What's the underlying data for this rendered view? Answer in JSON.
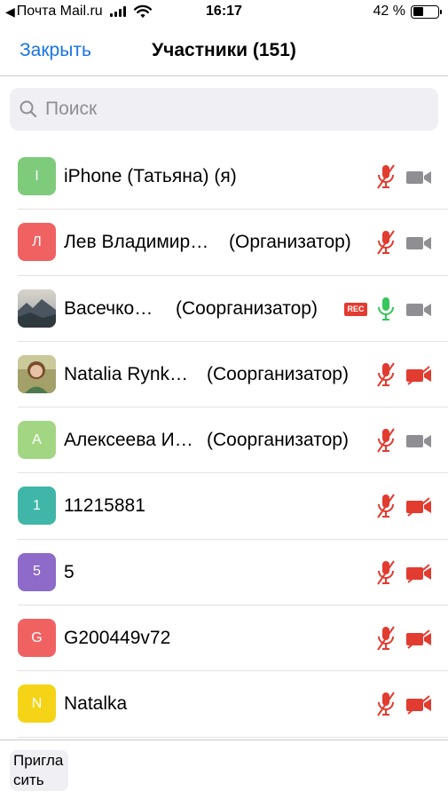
{
  "status_bar": {
    "carrier": "Почта Mail.ru",
    "time": "16:17",
    "battery_percent": "42 %",
    "battery_level": 0.42
  },
  "nav": {
    "close_label": "Закрыть",
    "title": "Участники (151)"
  },
  "search": {
    "placeholder": "Поиск"
  },
  "participants": [
    {
      "initial": "I",
      "name": "iPhone (Татьяна) (я)",
      "role": "",
      "avatar_color": "#7dcb7b",
      "avatar_type": "letter",
      "rec": false,
      "mic": "muted",
      "video": "on"
    },
    {
      "initial": "Л",
      "name": "Лев Владимир…",
      "role": "(Организатор)",
      "avatar_color": "#f06262",
      "avatar_type": "letter",
      "rec": false,
      "mic": "muted",
      "video": "on"
    },
    {
      "initial": "",
      "name": "Васечко…",
      "role": "(Соорганизатор)",
      "avatar_color": "#6f7d87",
      "avatar_type": "photo-landscape",
      "rec": true,
      "rec_label": "REC",
      "mic": "active",
      "video": "on"
    },
    {
      "initial": "",
      "name": "Natalia Rynk…",
      "role": "(Соорганизатор)",
      "avatar_color": "#8a8f5a",
      "avatar_type": "photo-person",
      "rec": false,
      "mic": "muted",
      "video": "off"
    },
    {
      "initial": "А",
      "name": "Алексеева И…",
      "role": "(Соорганизатор)",
      "avatar_color": "#a3d682",
      "avatar_type": "letter",
      "rec": false,
      "mic": "muted",
      "video": "on"
    },
    {
      "initial": "1",
      "name": "11215881",
      "role": "",
      "avatar_color": "#3fb6a8",
      "avatar_type": "letter",
      "rec": false,
      "mic": "muted",
      "video": "off"
    },
    {
      "initial": "5",
      "name": "5",
      "role": "",
      "avatar_color": "#8e6ac9",
      "avatar_type": "letter",
      "rec": false,
      "mic": "muted",
      "video": "off"
    },
    {
      "initial": "G",
      "name": "G200449v72",
      "role": "",
      "avatar_color": "#f06262",
      "avatar_type": "letter",
      "rec": false,
      "mic": "muted",
      "video": "off"
    },
    {
      "initial": "N",
      "name": "Natalka",
      "role": "",
      "avatar_color": "#f5d417",
      "avatar_type": "letter",
      "rec": false,
      "mic": "muted",
      "video": "off"
    }
  ],
  "bottom": {
    "invite_label": "Пригласить"
  },
  "colors": {
    "accent": "#1a73e8",
    "muted_red": "#e23b2f",
    "mic_active": "#34c759",
    "camera_gray": "#8e8e93"
  },
  "icons": {
    "search": "magnifier-icon",
    "mic_muted": "mic-muted-icon",
    "mic_active": "mic-icon",
    "video_on": "video-camera-icon",
    "video_off": "video-camera-off-icon"
  }
}
